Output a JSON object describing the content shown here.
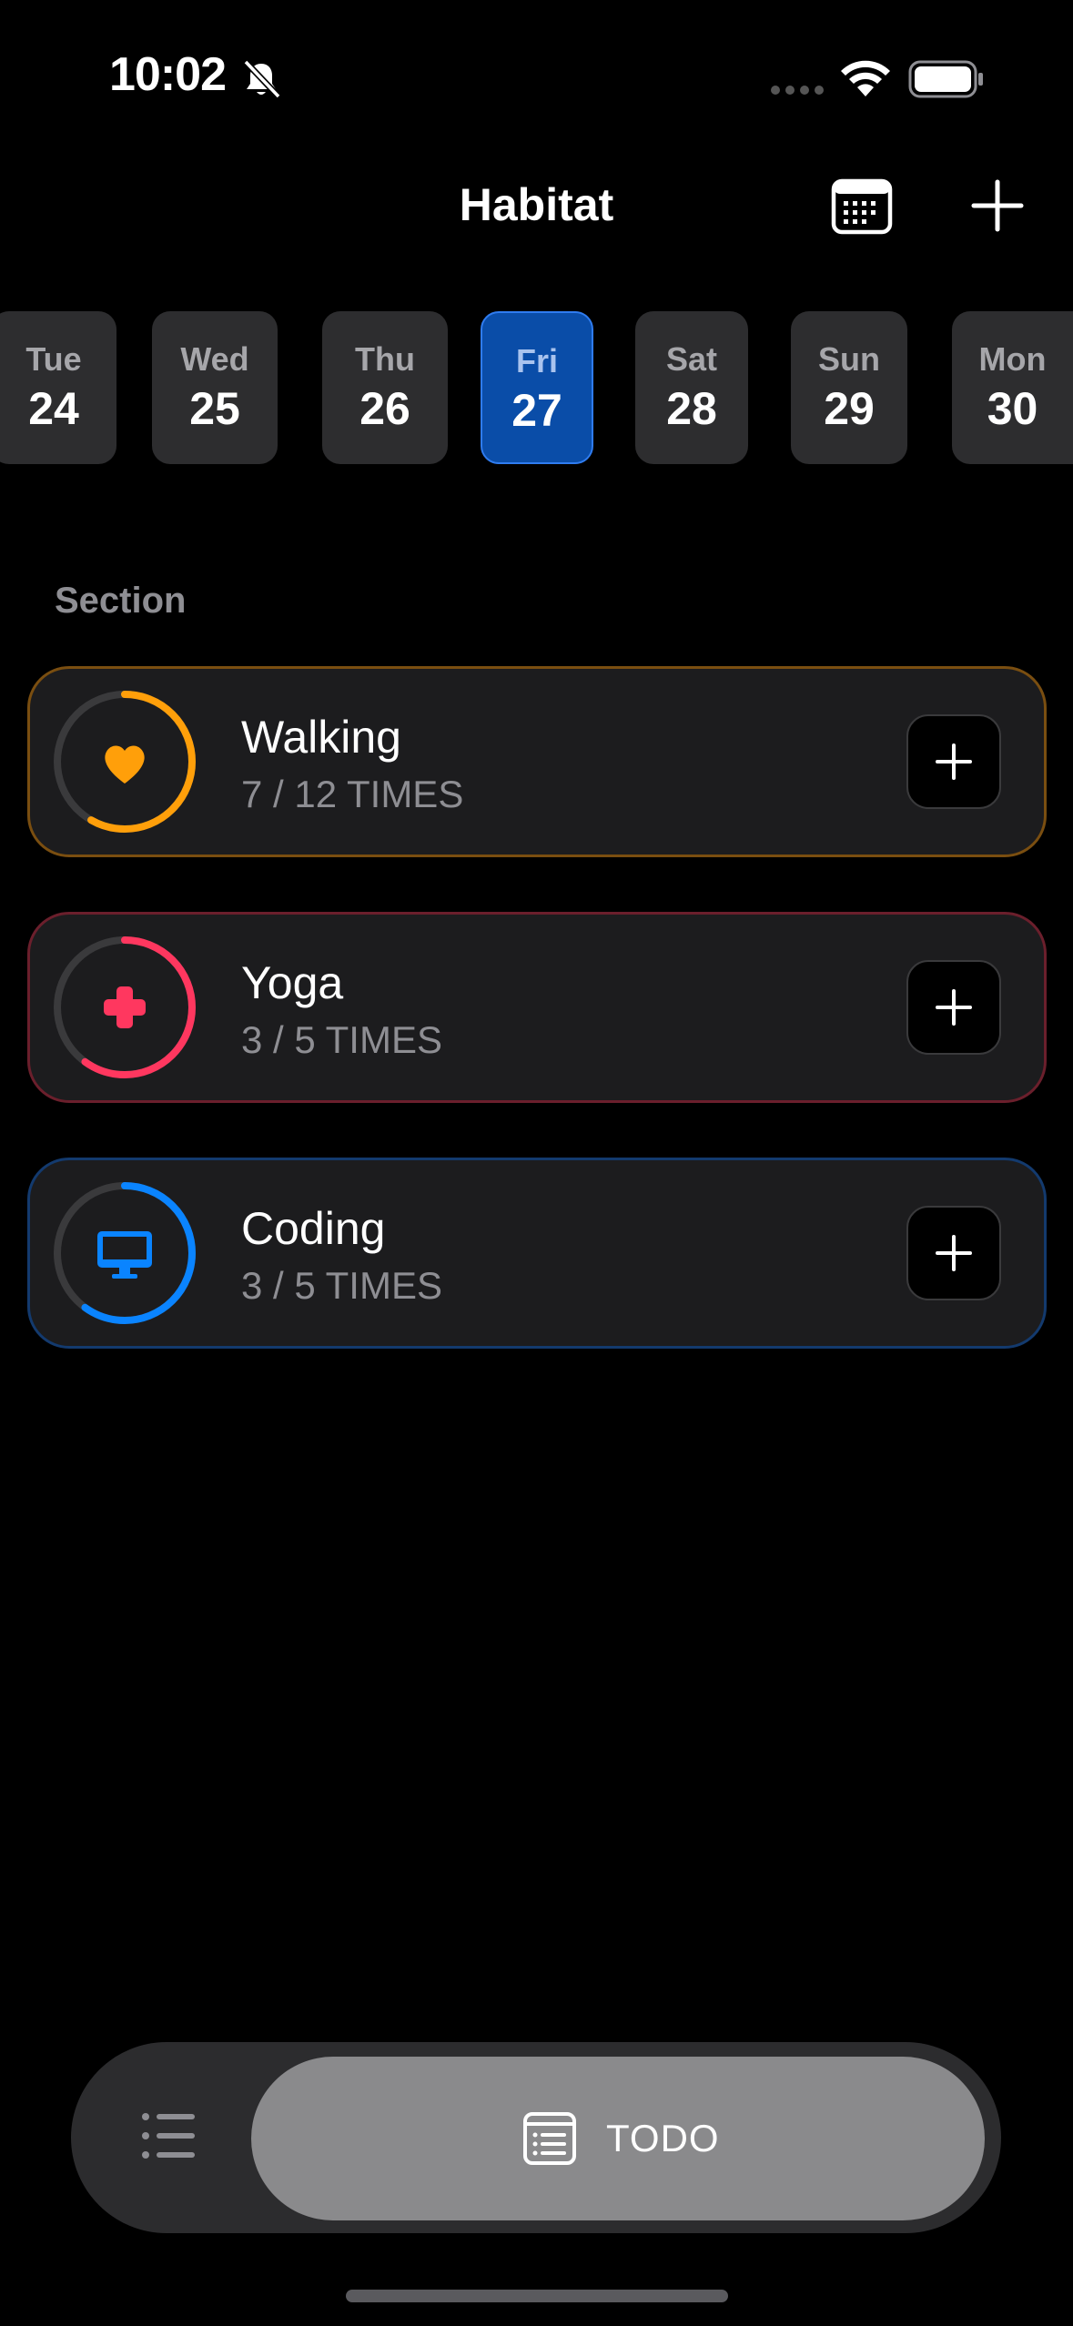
{
  "status_bar": {
    "time": "10:02"
  },
  "nav": {
    "title": "Habitat",
    "calendar_icon": "calendar-icon",
    "add_icon": "plus-icon"
  },
  "days": [
    {
      "dow": "Tue",
      "dom": "24",
      "selected": false
    },
    {
      "dow": "Wed",
      "dom": "25",
      "selected": false
    },
    {
      "dow": "Thu",
      "dom": "26",
      "selected": false
    },
    {
      "dow": "Fri",
      "dom": "27",
      "selected": true
    },
    {
      "dow": "Sat",
      "dom": "28",
      "selected": false
    },
    {
      "dow": "Sun",
      "dom": "29",
      "selected": false
    },
    {
      "dow": "Mon",
      "dom": "30",
      "selected": false
    }
  ],
  "section": {
    "label": "Section"
  },
  "habits": [
    {
      "name": "Walking",
      "progress_text": "7 / 12 TIMES",
      "progress": 0.583,
      "color": "#ff9f0a",
      "icon": "heart-icon"
    },
    {
      "name": "Yoga",
      "progress_text": "3 / 5 TIMES",
      "progress": 0.6,
      "color": "#ff375f",
      "icon": "medical-cross-icon"
    },
    {
      "name": "Coding",
      "progress_text": "3 / 5 TIMES",
      "progress": 0.6,
      "color": "#0a84ff",
      "icon": "desktop-computer-icon"
    }
  ],
  "tabbar": {
    "todo_label": "TODO",
    "list_icon": "list-icon",
    "todo_icon": "notes-icon"
  }
}
